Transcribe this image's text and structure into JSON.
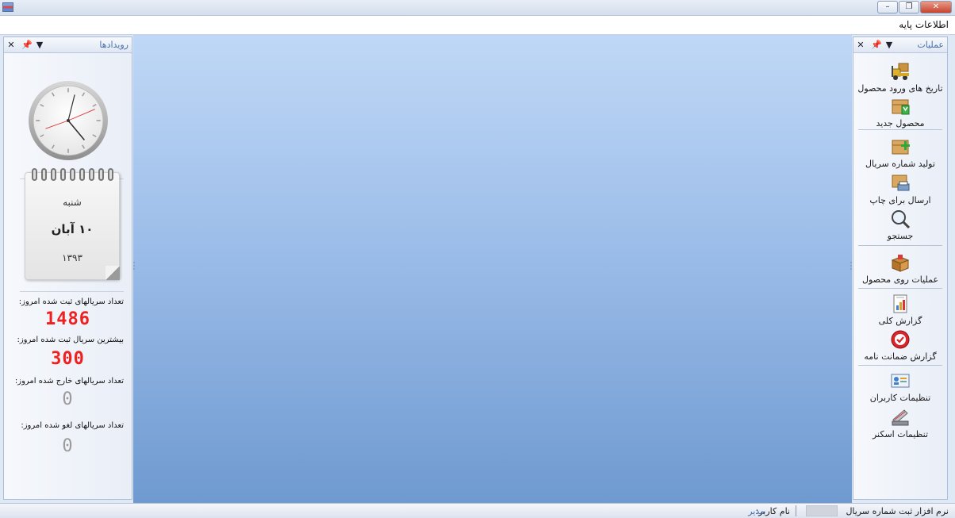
{
  "menu": {
    "base_info": "اطلاعات پایه"
  },
  "left_panel": {
    "title": "رویدادها",
    "calendar": {
      "weekday": "شنبه",
      "date": "۱۰ آبان",
      "year": "۱۳۹۳"
    },
    "stats": [
      {
        "label": "تعداد سریالهای ثبت شده امروز:",
        "value": "1486",
        "color": "#f02020"
      },
      {
        "label": "بیشترین سریال ثبت شده امروز:",
        "value": "300",
        "color": "#f02020"
      },
      {
        "label": "تعداد سریالهای خارج شده امروز:",
        "value": "0",
        "color": "#9a9a9a"
      },
      {
        "label": "تعداد سریالهای لغو شده امروز:",
        "value": "0",
        "color": "#9a9a9a"
      }
    ]
  },
  "right_panel": {
    "title": "عملیات",
    "actions": [
      {
        "label": "تاریخ های ورود محصول",
        "icon": "forklift-icon"
      },
      {
        "label": "محصول جدید",
        "icon": "new-box-icon"
      },
      {
        "label": "تولید شماره سریال",
        "icon": "box-add-icon"
      },
      {
        "label": "ارسال برای چاپ",
        "icon": "printer-box-icon"
      },
      {
        "label": "جستجو",
        "icon": "magnifier-icon"
      },
      {
        "label": "عملیات روی محصول",
        "icon": "open-box-icon"
      },
      {
        "label": "گزارش کلی",
        "icon": "report-chart-icon"
      },
      {
        "label": "گزارش ضمانت نامه",
        "icon": "warranty-seal-icon"
      },
      {
        "label": "تنظیمات کاربران",
        "icon": "user-card-icon"
      },
      {
        "label": "تنظیمات اسکنر",
        "icon": "scanner-icon"
      }
    ]
  },
  "status_bar": {
    "app_name": "نرم افزار ثبت شماره سریال",
    "username_label": "نام کاربر:",
    "username_value": "مدیر"
  },
  "colors": {
    "accent": "#4a6fa8",
    "digit_red": "#f02020",
    "digit_grey": "#9a9a9a"
  }
}
